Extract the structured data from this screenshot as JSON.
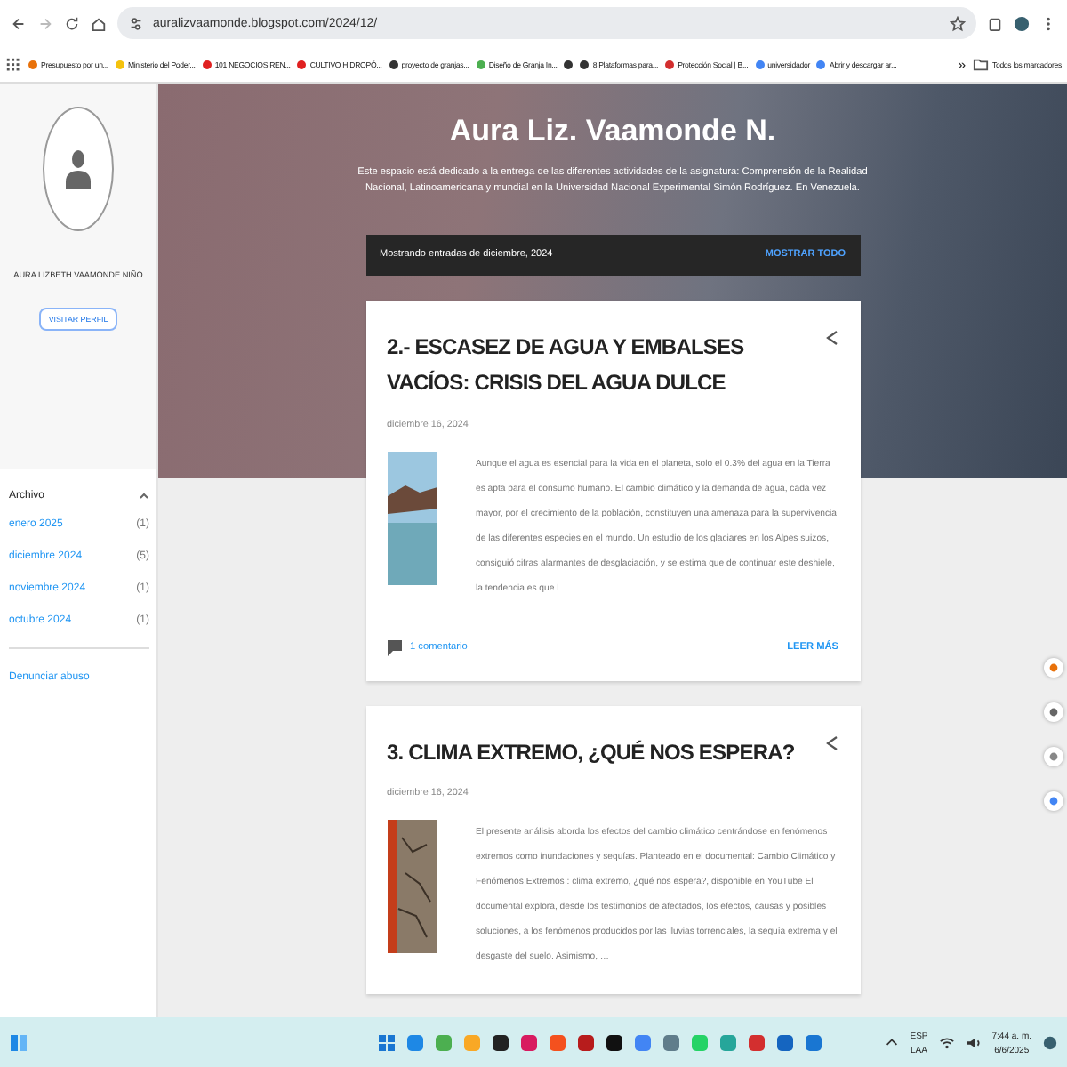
{
  "browser": {
    "url": "auralizvaamonde.blogspot.com/2024/12/"
  },
  "bookmarks": [
    {
      "kind": "link",
      "label": "Presupuesto por un...",
      "color": "#e8710a"
    },
    {
      "kind": "link",
      "label": "Ministerio del Poder...",
      "color": "#f4c20d"
    },
    {
      "kind": "link",
      "label": "101 NEGOCIOS REN...",
      "color": "#e02020"
    },
    {
      "kind": "link",
      "label": "CULTIVO HIDROPÓ...",
      "color": "#e02020"
    },
    {
      "kind": "link",
      "label": "proyecto de granjas...",
      "color": "#333333"
    },
    {
      "kind": "link",
      "label": "Diseño de Granja In...",
      "color": "#4caf50"
    },
    {
      "kind": "icon",
      "color": "#333333"
    },
    {
      "kind": "link",
      "label": "8 Plataformas para...",
      "color": "#333333"
    },
    {
      "kind": "link",
      "label": "Protección Social | B...",
      "color": "#d32f2f"
    },
    {
      "kind": "link",
      "label": "universidador",
      "color": "#4285f4"
    },
    {
      "kind": "link",
      "label": "Abrir y descargar ar...",
      "color": "#4285f4"
    }
  ],
  "bookmarks_more": "»",
  "all_bookmarks": "Todos los marcadores",
  "profile": {
    "name": "AURA LIZBETH VAAMONDE NIÑO",
    "button": "VISITAR PERFIL"
  },
  "archive": {
    "title": "Archivo",
    "expanded": true,
    "items": [
      {
        "label": "enero 2025",
        "count": "(1)"
      },
      {
        "label": "diciembre 2024",
        "count": "(5)"
      },
      {
        "label": "noviembre 2024",
        "count": "(1)"
      },
      {
        "label": "octubre 2024",
        "count": "(1)"
      }
    ]
  },
  "report_link": "Denunciar abuso",
  "blog": {
    "title": "Aura Liz. Vaamonde N.",
    "description": "Este espacio está dedicado a la entrega de las diferentes actividades de la asignatura: Comprensión de la Realidad Nacional, Latinoamericana y mundial en la Universidad Nacional Experimental Simón Rodríguez. En Venezuela."
  },
  "filter_bar": {
    "label": "Mostrando entradas de diciembre, 2024",
    "action": "MOSTRAR TODO"
  },
  "posts": [
    {
      "title": "2.- ESCASEZ DE AGUA Y EMBALSES VACÍOS: CRISIS DEL AGUA DULCE",
      "date": "diciembre 16, 2024",
      "excerpt": "Aunque el agua es esencial para la vida en el planeta, solo el 0.3% del agua en la Tierra es apta para el consumo humano. El cambio climático y la demanda de agua, cada vez mayor, por el crecimiento de la población, constituyen una amenaza para la supervivencia de las diferentes especies en el mundo. Un estudio de los glaciares en los Alpes suizos, consiguió cifras alarmantes de desglaciación, y se estima que de continuar este deshiele, la tendencia es que l …",
      "comments": "1 comentario",
      "read_more": "LEER MÁS"
    },
    {
      "title": "3. CLIMA EXTREMO, ¿QUÉ NOS ESPERA?",
      "date": "diciembre 16, 2024",
      "excerpt": "El presente análisis aborda los efectos del cambio climático centrándose en fenómenos extremos como inundaciones y sequías. Planteado en el documental: Cambio Climático y Fenómenos Extremos : clima extremo, ¿qué nos espera?, disponible en YouTube  El documental explora, desde los testimonios de afectados, los efectos, causas y posibles soluciones, a los fenómenos producidos por las lluvias torrenciales, la sequía extrema y el desgaste del suelo. Asimismo, …"
    }
  ],
  "taskbar": {
    "language": "ESP",
    "layout": "LAA",
    "time": "7:44 a. m.",
    "date": "6/6/2025"
  }
}
